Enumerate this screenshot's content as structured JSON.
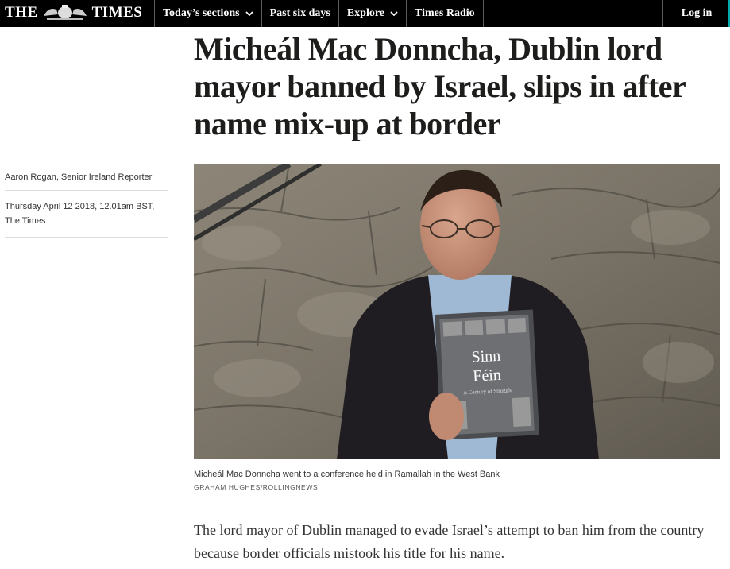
{
  "header": {
    "logo_left": "THE",
    "logo_right": "TIMES",
    "nav": [
      {
        "label": "Today’s sections",
        "has_dropdown": true
      },
      {
        "label": "Past six days",
        "has_dropdown": false
      },
      {
        "label": "Explore",
        "has_dropdown": true
      },
      {
        "label": "Times Radio",
        "has_dropdown": false
      }
    ],
    "login_label": "Log in"
  },
  "article": {
    "headline": "Micheál Mac Donncha, Dublin lord mayor banned by Israel, slips in after name mix-up at border",
    "author": "Aaron Rogan, Senior Ireland Reporter",
    "date_line1": "Thursday April 12 2018, 12.01am BST,",
    "date_line2": "The Times",
    "image": {
      "book_title_line1": "Sinn",
      "book_title_line2": "Féin",
      "book_subtitle": "A Century of Struggle"
    },
    "caption": "Micheál Mac Donncha went to a conference held in Ramallah in the West Bank",
    "credit": "GRAHAM HUGHES/ROLLINGNEWS",
    "lede": "The lord mayor of Dublin managed to evade Israel’s attempt to ban him from the country because border officials mistook his title for his name."
  },
  "colors": {
    "topbar": "#000000",
    "accent_edge": "#00aaaa",
    "headline_text": "#1d1d1b"
  }
}
